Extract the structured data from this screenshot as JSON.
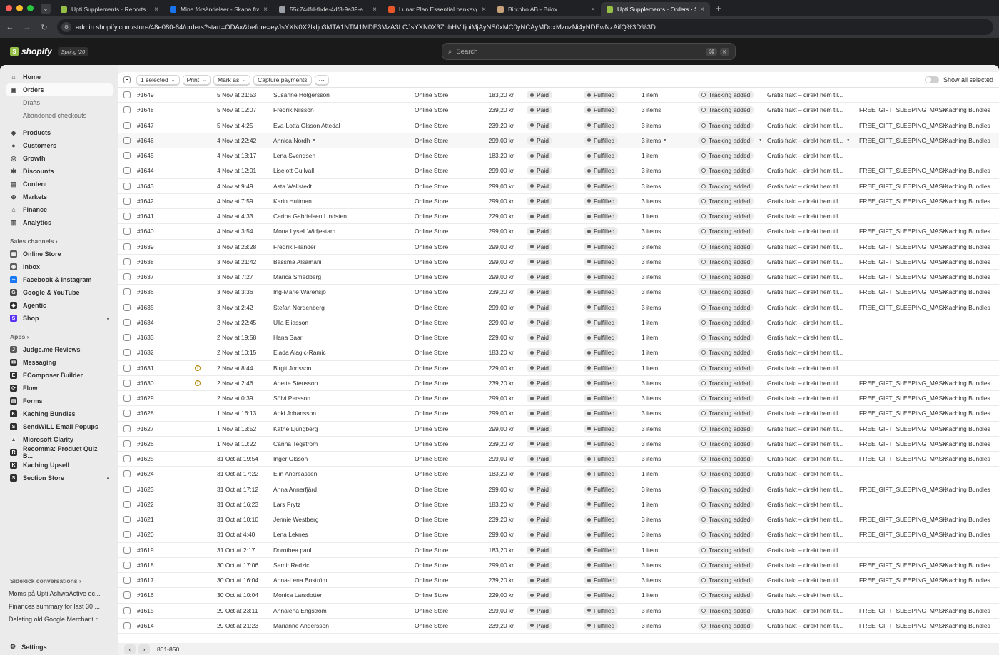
{
  "browser": {
    "tabs": [
      {
        "title": "Upti Supplements · Reports",
        "color": "#95bf47"
      },
      {
        "title": "Mina försändelser - Skapa frakt",
        "color": "#1a73e8"
      },
      {
        "title": "55c74dfd-fbde-4df3-9a39-a",
        "color": "#9aa0a6"
      },
      {
        "title": "Lunar Plan Essential bankavgift",
        "color": "#e8572a"
      },
      {
        "title": "Birchbo AB - Briox",
        "color": "#c8a27a"
      },
      {
        "title": "Upti Supplements · Orders · S",
        "color": "#95bf47",
        "active": true
      }
    ],
    "url": "admin.shopify.com/store/48e080-64/orders?start=ODAx&before=eyJsYXN0X2lkIjo3MTA1NTM1MDE3MzA3LCJsYXN0X3ZhbHVlIjoiMjAyNS0xMC0yNCAyMDoxMzozNi4yNDEwNzAifQ%3D%3D"
  },
  "topbar": {
    "logo": "shopify",
    "edition": "Spring '26",
    "search_placeholder": "Search",
    "kbd1": "⌘",
    "kbd2": "K"
  },
  "sidebar": {
    "home": "Home",
    "orders": "Orders",
    "drafts": "Drafts",
    "abandoned": "Abandoned checkouts",
    "products": "Products",
    "customers": "Customers",
    "growth": "Growth",
    "discounts": "Discounts",
    "content": "Content",
    "markets": "Markets",
    "finance": "Finance",
    "analytics": "Analytics",
    "sales_channels": "Sales channels",
    "channels": [
      "Online Store",
      "Inbox",
      "Facebook & Instagram",
      "Google & YouTube",
      "Agentic",
      "Shop"
    ],
    "apps_label": "Apps",
    "apps": [
      "Judge.me Reviews",
      "Messaging",
      "EComposer Builder",
      "Flow",
      "Forms",
      "Kaching Bundles",
      "SendWILL Email Popups",
      "Microsoft Clarity",
      "Recomma: Product Quiz B...",
      "Kaching Upsell",
      "Section Store"
    ],
    "sidekick_label": "Sidekick conversations",
    "sidekick": [
      "Moms på Upti AshwaActive oc...",
      "Finances summary for last 30 ...",
      "Deleting old Google Merchant r..."
    ],
    "settings": "Settings"
  },
  "bulkbar": {
    "selected": "1 selected",
    "print": "Print",
    "mark_as": "Mark as",
    "capture": "Capture payments",
    "more": "···",
    "show_all": "Show all selected"
  },
  "orders": [
    {
      "num": "#1649",
      "date": "5 Nov at 21:53",
      "customer": "Susanne Holgersson",
      "channel": "Online Store",
      "total": "183,20 kr",
      "payment": "Paid",
      "fulfillment": "Fulfilled",
      "items": "1 item",
      "tracking": "Tracking added",
      "delivery": "Gratis frakt – direkt hem til...",
      "tag1": "",
      "tag2": ""
    },
    {
      "num": "#1648",
      "date": "5 Nov at 12:07",
      "customer": "Fredrik Nilsson",
      "channel": "Online Store",
      "total": "239,20 kr",
      "payment": "Paid",
      "fulfillment": "Fulfilled",
      "items": "3 items",
      "tracking": "Tracking added",
      "delivery": "Gratis frakt – direkt hem til...",
      "tag1": "FREE_GIFT_SLEEPING_MASK",
      "tag2": "Kaching Bundles"
    },
    {
      "num": "#1647",
      "date": "5 Nov at 4:25",
      "customer": "Eva-Lotta Olsson Attedal",
      "channel": "Online Store",
      "total": "239,20 kr",
      "payment": "Paid",
      "fulfillment": "Fulfilled",
      "items": "3 items",
      "tracking": "Tracking added",
      "delivery": "Gratis frakt – direkt hem til...",
      "tag1": "FREE_GIFT_SLEEPING_MASK",
      "tag2": "Kaching Bundles"
    },
    {
      "num": "#1646",
      "date": "4 Nov at 22:42",
      "customer": "Annica Nordh",
      "channel": "Online Store",
      "total": "299,00 kr",
      "payment": "Paid",
      "fulfillment": "Fulfilled",
      "items": "3 items",
      "tracking": "Tracking added",
      "delivery": "Gratis frakt – direkt hem til...",
      "tag1": "FREE_GIFT_SLEEPING_MASK",
      "tag2": "Kaching Bundles",
      "hover": true
    },
    {
      "num": "#1645",
      "date": "4 Nov at 13:17",
      "customer": "Lena Svendsen",
      "channel": "Online Store",
      "total": "183,20 kr",
      "payment": "Paid",
      "fulfillment": "Fulfilled",
      "items": "1 item",
      "tracking": "Tracking added",
      "delivery": "Gratis frakt – direkt hem til...",
      "tag1": "",
      "tag2": ""
    },
    {
      "num": "#1644",
      "date": "4 Nov at 12:01",
      "customer": "Liselott Gullvall",
      "channel": "Online Store",
      "total": "299,00 kr",
      "payment": "Paid",
      "fulfillment": "Fulfilled",
      "items": "3 items",
      "tracking": "Tracking added",
      "delivery": "Gratis frakt – direkt hem til...",
      "tag1": "FREE_GIFT_SLEEPING_MASK",
      "tag2": "Kaching Bundles"
    },
    {
      "num": "#1643",
      "date": "4 Nov at 9:49",
      "customer": "Asta Wallstedt",
      "channel": "Online Store",
      "total": "299,00 kr",
      "payment": "Paid",
      "fulfillment": "Fulfilled",
      "items": "3 items",
      "tracking": "Tracking added",
      "delivery": "Gratis frakt – direkt hem til...",
      "tag1": "FREE_GIFT_SLEEPING_MASK",
      "tag2": "Kaching Bundles"
    },
    {
      "num": "#1642",
      "date": "4 Nov at 7:59",
      "customer": "Karin Hultman",
      "channel": "Online Store",
      "total": "299,00 kr",
      "payment": "Paid",
      "fulfillment": "Fulfilled",
      "items": "3 items",
      "tracking": "Tracking added",
      "delivery": "Gratis frakt – direkt hem til...",
      "tag1": "FREE_GIFT_SLEEPING_MASK",
      "tag2": "Kaching Bundles"
    },
    {
      "num": "#1641",
      "date": "4 Nov at 4:33",
      "customer": "Carina Gabrielsen Lindsten",
      "channel": "Online Store",
      "total": "229,00 kr",
      "payment": "Paid",
      "fulfillment": "Fulfilled",
      "items": "1 item",
      "tracking": "Tracking added",
      "delivery": "Gratis frakt – direkt hem til...",
      "tag1": "",
      "tag2": ""
    },
    {
      "num": "#1640",
      "date": "4 Nov at 3:54",
      "customer": "Mona Lysell Widjestam",
      "channel": "Online Store",
      "total": "299,00 kr",
      "payment": "Paid",
      "fulfillment": "Fulfilled",
      "items": "3 items",
      "tracking": "Tracking added",
      "delivery": "Gratis frakt – direkt hem til...",
      "tag1": "FREE_GIFT_SLEEPING_MASK",
      "tag2": "Kaching Bundles"
    },
    {
      "num": "#1639",
      "date": "3 Nov at 23:28",
      "customer": "Fredrik Filander",
      "channel": "Online Store",
      "total": "299,00 kr",
      "payment": "Paid",
      "fulfillment": "Fulfilled",
      "items": "3 items",
      "tracking": "Tracking added",
      "delivery": "Gratis frakt – direkt hem til...",
      "tag1": "FREE_GIFT_SLEEPING_MASK",
      "tag2": "Kaching Bundles"
    },
    {
      "num": "#1638",
      "date": "3 Nov at 21:42",
      "customer": "Bassma Alsamani",
      "channel": "Online Store",
      "total": "299,00 kr",
      "payment": "Paid",
      "fulfillment": "Fulfilled",
      "items": "3 items",
      "tracking": "Tracking added",
      "delivery": "Gratis frakt – direkt hem til...",
      "tag1": "FREE_GIFT_SLEEPING_MASK",
      "tag2": "Kaching Bundles"
    },
    {
      "num": "#1637",
      "date": "3 Nov at 7:27",
      "customer": "Marica Smedberg",
      "channel": "Online Store",
      "total": "299,00 kr",
      "payment": "Paid",
      "fulfillment": "Fulfilled",
      "items": "3 items",
      "tracking": "Tracking added",
      "delivery": "Gratis frakt – direkt hem til...",
      "tag1": "FREE_GIFT_SLEEPING_MASK",
      "tag2": "Kaching Bundles"
    },
    {
      "num": "#1636",
      "date": "3 Nov at 3:36",
      "customer": "Ing-Marie Warensjö",
      "channel": "Online Store",
      "total": "239,20 kr",
      "payment": "Paid",
      "fulfillment": "Fulfilled",
      "items": "3 items",
      "tracking": "Tracking added",
      "delivery": "Gratis frakt – direkt hem til...",
      "tag1": "FREE_GIFT_SLEEPING_MASK",
      "tag2": "Kaching Bundles"
    },
    {
      "num": "#1635",
      "date": "3 Nov at 2:42",
      "customer": "Stefan Nordenberg",
      "channel": "Online Store",
      "total": "299,00 kr",
      "payment": "Paid",
      "fulfillment": "Fulfilled",
      "items": "3 items",
      "tracking": "Tracking added",
      "delivery": "Gratis frakt – direkt hem til...",
      "tag1": "FREE_GIFT_SLEEPING_MASK",
      "tag2": "Kaching Bundles"
    },
    {
      "num": "#1634",
      "date": "2 Nov at 22:45",
      "customer": "Ulla Eliasson",
      "channel": "Online Store",
      "total": "229,00 kr",
      "payment": "Paid",
      "fulfillment": "Fulfilled",
      "items": "1 item",
      "tracking": "Tracking added",
      "delivery": "Gratis frakt – direkt hem til...",
      "tag1": "",
      "tag2": ""
    },
    {
      "num": "#1633",
      "date": "2 Nov at 19:58",
      "customer": "Hana Saari",
      "channel": "Online Store",
      "total": "229,00 kr",
      "payment": "Paid",
      "fulfillment": "Fulfilled",
      "items": "1 item",
      "tracking": "Tracking added",
      "delivery": "Gratis frakt – direkt hem til...",
      "tag1": "",
      "tag2": ""
    },
    {
      "num": "#1632",
      "date": "2 Nov at 10:15",
      "customer": "Elada Alagic-Ramic",
      "channel": "Online Store",
      "total": "183,20 kr",
      "payment": "Paid",
      "fulfillment": "Fulfilled",
      "items": "1 item",
      "tracking": "Tracking added",
      "delivery": "Gratis frakt – direkt hem til...",
      "tag1": "",
      "tag2": ""
    },
    {
      "num": "#1631",
      "date": "2 Nov at 8:44",
      "customer": "Birgit Jonsson",
      "channel": "Online Store",
      "total": "229,00 kr",
      "payment": "Paid",
      "fulfillment": "Fulfilled",
      "items": "1 item",
      "tracking": "Tracking added",
      "delivery": "Gratis frakt – direkt hem til...",
      "tag1": "",
      "tag2": "",
      "flag": true
    },
    {
      "num": "#1630",
      "date": "2 Nov at 2:46",
      "customer": "Anette Stensson",
      "channel": "Online Store",
      "total": "239,20 kr",
      "payment": "Paid",
      "fulfillment": "Fulfilled",
      "items": "3 items",
      "tracking": "Tracking added",
      "delivery": "Gratis frakt – direkt hem til...",
      "tag1": "FREE_GIFT_SLEEPING_MASK",
      "tag2": "Kaching Bundles",
      "flag": true
    },
    {
      "num": "#1629",
      "date": "2 Nov at 0:39",
      "customer": "Sölvi Persson",
      "channel": "Online Store",
      "total": "299,00 kr",
      "payment": "Paid",
      "fulfillment": "Fulfilled",
      "items": "3 items",
      "tracking": "Tracking added",
      "delivery": "Gratis frakt – direkt hem til...",
      "tag1": "FREE_GIFT_SLEEPING_MASK",
      "tag2": "Kaching Bundles"
    },
    {
      "num": "#1628",
      "date": "1 Nov at 16:13",
      "customer": "Anki Johansson",
      "channel": "Online Store",
      "total": "299,00 kr",
      "payment": "Paid",
      "fulfillment": "Fulfilled",
      "items": "3 items",
      "tracking": "Tracking added",
      "delivery": "Gratis frakt – direkt hem til...",
      "tag1": "FREE_GIFT_SLEEPING_MASK",
      "tag2": "Kaching Bundles"
    },
    {
      "num": "#1627",
      "date": "1 Nov at 13:52",
      "customer": "Kathe Ljungberg",
      "channel": "Online Store",
      "total": "299,00 kr",
      "payment": "Paid",
      "fulfillment": "Fulfilled",
      "items": "3 items",
      "tracking": "Tracking added",
      "delivery": "Gratis frakt – direkt hem til...",
      "tag1": "FREE_GIFT_SLEEPING_MASK",
      "tag2": "Kaching Bundles"
    },
    {
      "num": "#1626",
      "date": "1 Nov at 10:22",
      "customer": "Carina Tegström",
      "channel": "Online Store",
      "total": "239,20 kr",
      "payment": "Paid",
      "fulfillment": "Fulfilled",
      "items": "3 items",
      "tracking": "Tracking added",
      "delivery": "Gratis frakt – direkt hem til...",
      "tag1": "FREE_GIFT_SLEEPING_MASK",
      "tag2": "Kaching Bundles"
    },
    {
      "num": "#1625",
      "date": "31 Oct at 19:54",
      "customer": "Inger Olsson",
      "channel": "Online Store",
      "total": "299,00 kr",
      "payment": "Paid",
      "fulfillment": "Fulfilled",
      "items": "3 items",
      "tracking": "Tracking added",
      "delivery": "Gratis frakt – direkt hem til...",
      "tag1": "FREE_GIFT_SLEEPING_MASK",
      "tag2": "Kaching Bundles"
    },
    {
      "num": "#1624",
      "date": "31 Oct at 17:22",
      "customer": "Elin Andreassen",
      "channel": "Online Store",
      "total": "183,20 kr",
      "payment": "Paid",
      "fulfillment": "Fulfilled",
      "items": "1 item",
      "tracking": "Tracking added",
      "delivery": "Gratis frakt – direkt hem til...",
      "tag1": "",
      "tag2": ""
    },
    {
      "num": "#1623",
      "date": "31 Oct at 17:12",
      "customer": "Anna Annerfjärd",
      "channel": "Online Store",
      "total": "299,00 kr",
      "payment": "Paid",
      "fulfillment": "Fulfilled",
      "items": "3 items",
      "tracking": "Tracking added",
      "delivery": "Gratis frakt – direkt hem til...",
      "tag1": "FREE_GIFT_SLEEPING_MASK",
      "tag2": "Kaching Bundles"
    },
    {
      "num": "#1622",
      "date": "31 Oct at 16:23",
      "customer": "Lars Prytz",
      "channel": "Online Store",
      "total": "183,20 kr",
      "payment": "Paid",
      "fulfillment": "Fulfilled",
      "items": "1 item",
      "tracking": "Tracking added",
      "delivery": "Gratis frakt – direkt hem til...",
      "tag1": "",
      "tag2": ""
    },
    {
      "num": "#1621",
      "date": "31 Oct at 10:10",
      "customer": "Jennie Westberg",
      "channel": "Online Store",
      "total": "239,20 kr",
      "payment": "Paid",
      "fulfillment": "Fulfilled",
      "items": "3 items",
      "tracking": "Tracking added",
      "delivery": "Gratis frakt – direkt hem til...",
      "tag1": "FREE_GIFT_SLEEPING_MASK",
      "tag2": "Kaching Bundles"
    },
    {
      "num": "#1620",
      "date": "31 Oct at 4:40",
      "customer": "Lena Leknes",
      "channel": "Online Store",
      "total": "299,00 kr",
      "payment": "Paid",
      "fulfillment": "Fulfilled",
      "items": "3 items",
      "tracking": "Tracking added",
      "delivery": "Gratis frakt – direkt hem til...",
      "tag1": "FREE_GIFT_SLEEPING_MASK",
      "tag2": "Kaching Bundles"
    },
    {
      "num": "#1619",
      "date": "31 Oct at 2:17",
      "customer": "Dorothea paul",
      "channel": "Online Store",
      "total": "183,20 kr",
      "payment": "Paid",
      "fulfillment": "Fulfilled",
      "items": "1 item",
      "tracking": "Tracking added",
      "delivery": "Gratis frakt – direkt hem til...",
      "tag1": "",
      "tag2": ""
    },
    {
      "num": "#1618",
      "date": "30 Oct at 17:06",
      "customer": "Semir Redzic",
      "channel": "Online Store",
      "total": "299,00 kr",
      "payment": "Paid",
      "fulfillment": "Fulfilled",
      "items": "3 items",
      "tracking": "Tracking added",
      "delivery": "Gratis frakt – direkt hem til...",
      "tag1": "FREE_GIFT_SLEEPING_MASK",
      "tag2": "Kaching Bundles"
    },
    {
      "num": "#1617",
      "date": "30 Oct at 16:04",
      "customer": "Anna-Lena Boström",
      "channel": "Online Store",
      "total": "239,20 kr",
      "payment": "Paid",
      "fulfillment": "Fulfilled",
      "items": "3 items",
      "tracking": "Tracking added",
      "delivery": "Gratis frakt – direkt hem til...",
      "tag1": "FREE_GIFT_SLEEPING_MASK",
      "tag2": "Kaching Bundles"
    },
    {
      "num": "#1616",
      "date": "30 Oct at 10:04",
      "customer": "Monica Larsdotter",
      "channel": "Online Store",
      "total": "229,00 kr",
      "payment": "Paid",
      "fulfillment": "Fulfilled",
      "items": "1 item",
      "tracking": "Tracking added",
      "delivery": "Gratis frakt – direkt hem til...",
      "tag1": "",
      "tag2": ""
    },
    {
      "num": "#1615",
      "date": "29 Oct at 23:11",
      "customer": "Annalena Engström",
      "channel": "Online Store",
      "total": "299,00 kr",
      "payment": "Paid",
      "fulfillment": "Fulfilled",
      "items": "3 items",
      "tracking": "Tracking added",
      "delivery": "Gratis frakt – direkt hem til...",
      "tag1": "FREE_GIFT_SLEEPING_MASK",
      "tag2": "Kaching Bundles"
    },
    {
      "num": "#1614",
      "date": "29 Oct at 21:23",
      "customer": "Marianne Andersson",
      "channel": "Online Store",
      "total": "239,20 kr",
      "payment": "Paid",
      "fulfillment": "Fulfilled",
      "items": "3 items",
      "tracking": "Tracking added",
      "delivery": "Gratis frakt – direkt hem til...",
      "tag1": "FREE_GIFT_SLEEPING_MASK",
      "tag2": "Kaching Bundles"
    }
  ],
  "pagination": {
    "prev": "‹",
    "next": "›",
    "range": "801-850"
  }
}
